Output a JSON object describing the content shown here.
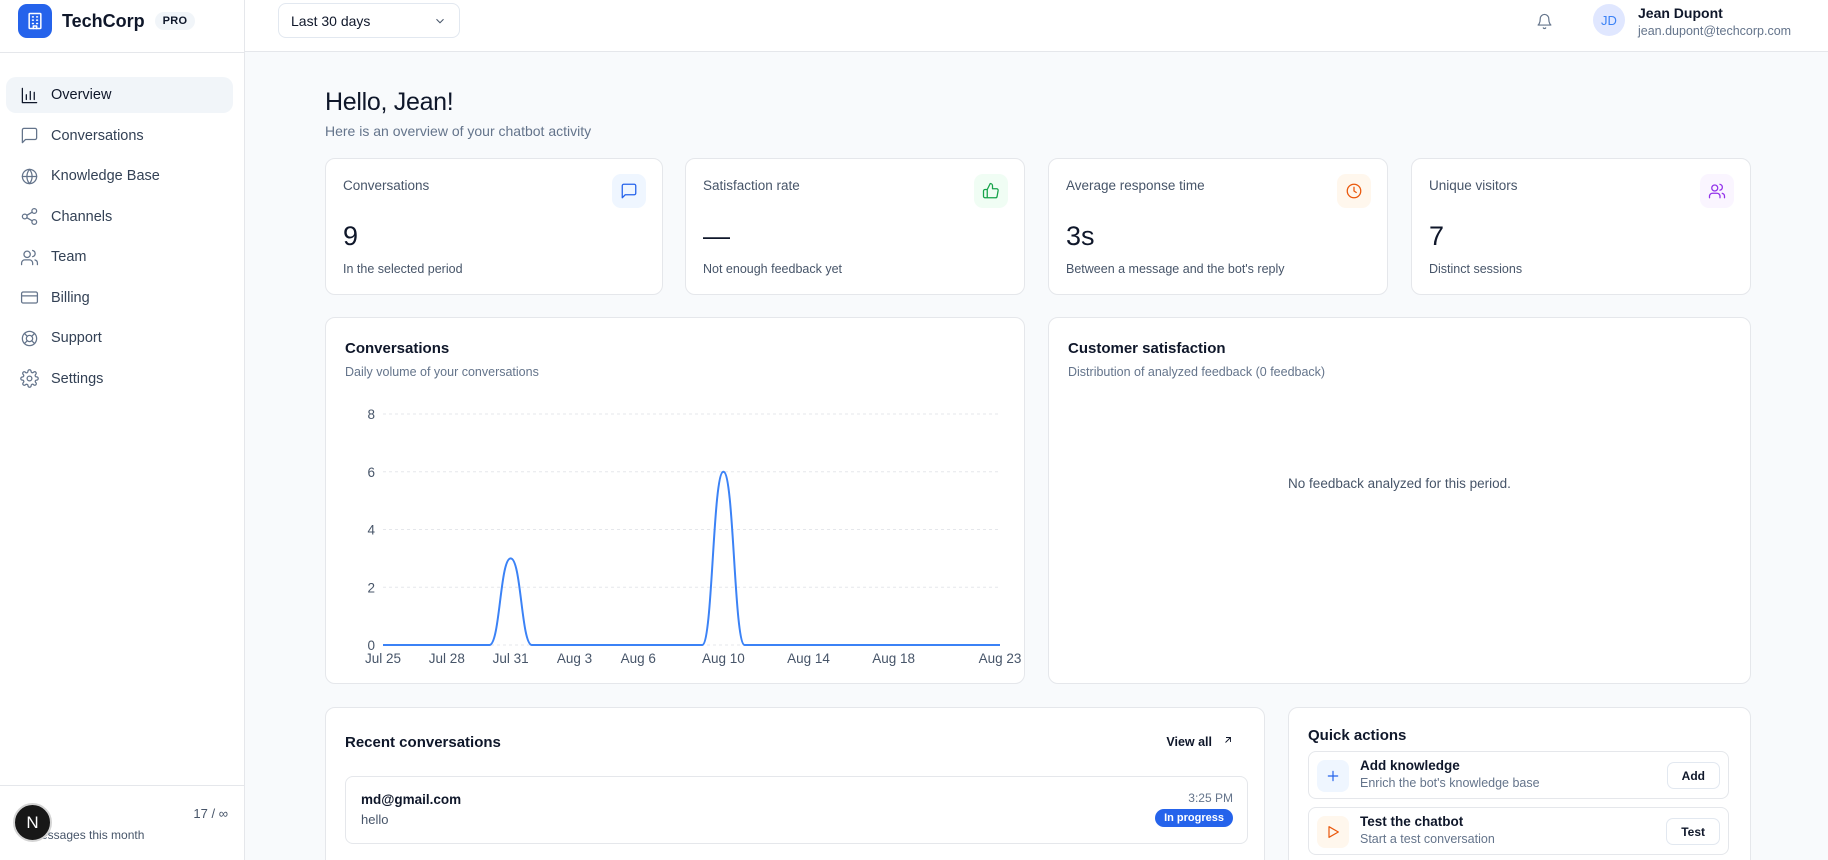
{
  "brand": {
    "name": "TechCorp",
    "plan": "PRO"
  },
  "sidebar": {
    "items": [
      {
        "label": "Overview",
        "icon": "bar-chart-icon",
        "active": true
      },
      {
        "label": "Conversations",
        "icon": "message-square-icon"
      },
      {
        "label": "Knowledge Base",
        "icon": "globe-icon"
      },
      {
        "label": "Channels",
        "icon": "share-icon"
      },
      {
        "label": "Team",
        "icon": "users-icon"
      },
      {
        "label": "Billing",
        "icon": "credit-card-icon"
      },
      {
        "label": "Support",
        "icon": "life-buoy-icon"
      },
      {
        "label": "Settings",
        "icon": "gear-icon"
      }
    ],
    "footer": {
      "avatar_letter": "N",
      "usage": "17 / ∞",
      "usage_label": "essages this month"
    }
  },
  "header": {
    "period": "Last 30 days",
    "user": {
      "initials": "JD",
      "name": "Jean Dupont",
      "email": "jean.dupont@techcorp.com"
    }
  },
  "main": {
    "greeting": "Hello, Jean!",
    "subtitle": "Here is an overview of your chatbot activity",
    "stats": [
      {
        "title": "Conversations",
        "value": "9",
        "sub": "In the selected period",
        "icon": "message-square-icon",
        "color": "#2563eb",
        "bg": "#eff6ff"
      },
      {
        "title": "Satisfaction rate",
        "value": "—",
        "sub": "Not enough feedback yet",
        "icon": "thumbs-up-icon",
        "color": "#16a34a",
        "bg": "#f0fdf4"
      },
      {
        "title": "Average response time",
        "value": "3s",
        "sub": "Between a message and the bot's reply",
        "icon": "clock-icon",
        "color": "#ea580c",
        "bg": "#fff7ed"
      },
      {
        "title": "Unique visitors",
        "value": "7",
        "sub": "Distinct sessions",
        "icon": "users-icon",
        "color": "#9333ea",
        "bg": "#faf5ff"
      }
    ],
    "conversations_chart": {
      "title": "Conversations",
      "subtitle": "Daily volume of your conversations"
    },
    "satisfaction": {
      "title": "Customer satisfaction",
      "subtitle": "Distribution of analyzed feedback (0 feedback)",
      "empty": "No feedback analyzed for this period."
    },
    "recent": {
      "title": "Recent conversations",
      "view_all": "View all",
      "items": [
        {
          "email": "md@gmail.com",
          "text": "hello",
          "time": "3:25 PM",
          "status": "In progress"
        }
      ]
    },
    "quick_actions": {
      "title": "Quick actions",
      "items": [
        {
          "name": "Add knowledge",
          "desc": "Enrich the bot's knowledge base",
          "button": "Add",
          "icon": "plus-icon",
          "color": "#2563eb",
          "bg": "#eff6ff"
        },
        {
          "name": "Test the chatbot",
          "desc": "Start a test conversation",
          "button": "Test",
          "icon": "play-icon",
          "color": "#ea580c",
          "bg": "#fff7ed"
        }
      ]
    }
  },
  "chart_data": {
    "type": "line",
    "x": [
      "Jul 25",
      "Jul 26",
      "Jul 27",
      "Jul 28",
      "Jul 29",
      "Jul 30",
      "Jul 31",
      "Aug 1",
      "Aug 2",
      "Aug 3",
      "Aug 4",
      "Aug 5",
      "Aug 6",
      "Aug 7",
      "Aug 8",
      "Aug 9",
      "Aug 10",
      "Aug 11",
      "Aug 12",
      "Aug 13",
      "Aug 14",
      "Aug 15",
      "Aug 16",
      "Aug 17",
      "Aug 18",
      "Aug 19",
      "Aug 20",
      "Aug 21",
      "Aug 22",
      "Aug 23"
    ],
    "series": [
      {
        "values": [
          0,
          0,
          0,
          0,
          0,
          0,
          3,
          0,
          0,
          0,
          0,
          0,
          0,
          0,
          0,
          0,
          6,
          0,
          0,
          0,
          0,
          0,
          0,
          0,
          0,
          0,
          0,
          0,
          0,
          0
        ]
      }
    ],
    "tick_labels": [
      "Jul 25",
      "Jul 28",
      "Jul 31",
      "Aug 3",
      "Aug 6",
      "Aug 10",
      "Aug 14",
      "Aug 18",
      "Aug 23"
    ],
    "yticks": [
      0,
      2,
      4,
      6,
      8
    ],
    "ylim": [
      0,
      8
    ],
    "color": "#3b82f6",
    "grid": true
  }
}
